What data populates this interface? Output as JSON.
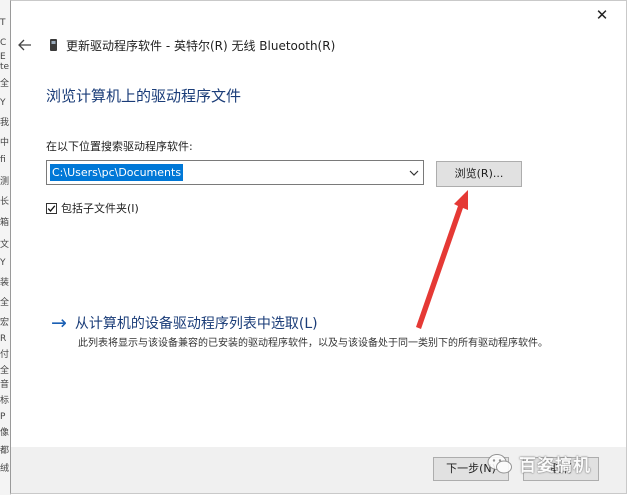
{
  "background_window": {
    "fragments": [
      "T",
      "C",
      "E",
      "te",
      "全",
      "Y",
      "我",
      "中",
      "fi",
      "测",
      "长",
      "箱",
      "文",
      "Y",
      "装",
      "全",
      "宏",
      "R",
      "付",
      "全",
      "音",
      "标",
      "P",
      "像",
      "都",
      "绒"
    ]
  },
  "dialog": {
    "close_glyph": "✕",
    "title": "更新驱动程序软件 - 英特尔(R) 无线 Bluetooth(R)",
    "heading": "浏览计算机上的驱动程序文件",
    "search_label": "在以下位置搜索驱动程序软件:",
    "path_value": "C:\\Users\\pc\\Documents",
    "browse_label": "浏览(R)...",
    "include_subfolders_label": "包括子文件夹(I)",
    "include_subfolders_checked": true,
    "pick_link": {
      "arrow": "→",
      "label": "从计算机的设备驱动程序列表中选取(L)",
      "description": "此列表将显示与该设备兼容的已安装的驱动程序软件，以及与该设备处于同一类别下的所有驱动程序软件。"
    },
    "next_label": "下一步(N)",
    "cancel_label": "取消"
  },
  "watermark": {
    "text": "百姿搞机"
  },
  "icons": {
    "back": "back-arrow-icon",
    "device": "device-icon",
    "dropdown": "chevron-down-icon",
    "check": "checkmark-icon",
    "watermark_logo": "wechat-logo-icon"
  },
  "colors": {
    "heading": "#1a3c78",
    "link_arrow": "#1a5fb4",
    "selection": "#0078d7",
    "annotation_arrow": "#e53935"
  }
}
